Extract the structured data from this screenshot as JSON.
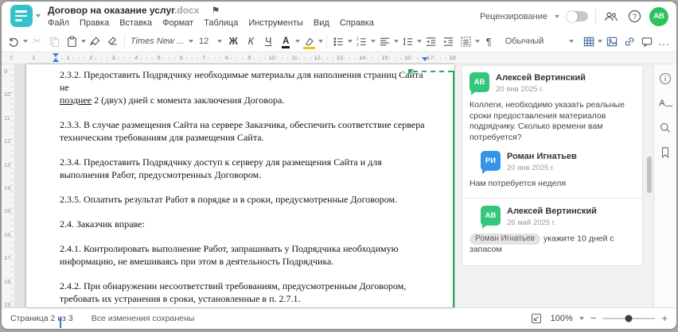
{
  "header": {
    "title": "Договор на оказание услуг",
    "title_ext": ".docx",
    "menu": [
      "Файл",
      "Правка",
      "Вставка",
      "Формат",
      "Таблица",
      "Инструменты",
      "Вид",
      "Справка"
    ],
    "review_label": "Рецензирование",
    "avatar_initials": "АВ"
  },
  "toolbar": {
    "font_name": "Times New ...",
    "font_size": "12",
    "bold_label": "Ж",
    "italic_label": "К",
    "underline_label": "Ч",
    "font_color_label": "А",
    "style_name": "Обычный",
    "pilcrow": "¶",
    "more_label": "..."
  },
  "ruler": {
    "h_left": [
      "2",
      "1"
    ],
    "h_numbers": [
      "1",
      "2",
      "3",
      "4",
      "5",
      "6",
      "7",
      "8",
      "9",
      "10",
      "11",
      "12",
      "13",
      "14",
      "15",
      "16",
      "17",
      "18"
    ],
    "v_numbers": [
      "9",
      "10",
      "11",
      "12",
      "13",
      "14",
      "15",
      "16",
      "17",
      "18",
      "19"
    ]
  },
  "document": {
    "p1_line1": "2.3.2. Предоставить Подрядчику необходимые материалы для наполнения страниц Сайта не",
    "p1_underlined": "позднее",
    "p1_rest": " 2 (двух) дней с момента заключения Договора.",
    "p2": "2.3.3. В случае размещения Сайта на сервере Заказчика, обеспечить соответствие сервера техническим требованиям для размещения Сайта.",
    "p3": "2.3.4. Предоставить Подрядчику доступ к серверу для размещения Сайта и для выполнения Работ, предусмотренных Договором.",
    "p4": "2.3.5. Оплатить результат Работ в порядке и в сроки, предусмотренные Договором.",
    "p5": "2.4. Заказчик вправе:",
    "p6": "2.4.1. Контролировать выполнение Работ, запрашивать у Подрядчика необходимую информацию, не вмешиваясь при этом в деятельность Подрядчика.",
    "p7": "2.4.2. При обнаружении несоответствий требованиям, предусмотренным Договором, требовать их устранения в сроки, установленные в п. 2.7.1."
  },
  "comments": {
    "items": [
      {
        "initials": "АВ",
        "name": "Алексей Вертинский",
        "date": "20 янв 2025 г.",
        "text": "Коллеги, необходимо указать реальные сроки предоставления материалов подрядчику. Сколько времени вам потребуется?"
      },
      {
        "initials": "РИ",
        "name": "Роман Игнатьев",
        "date": "20 янв 2025 г.",
        "text": "Нам потребуется неделя"
      },
      {
        "initials": "АВ",
        "name": "Алексей Вертинский",
        "date": "26 май 2025 г.",
        "mention": "Роман Игнатьев",
        "text": "укажите 10 дней с запасом"
      }
    ]
  },
  "statusbar": {
    "page_label": "Страница 2 из 3",
    "saved_label": "Все изменения сохранены",
    "zoom_value": "100%",
    "minus": "−",
    "plus": "+"
  },
  "colors": {
    "app_teal": "#35c1cc",
    "collab_green": "#21ae57",
    "avatar_green": "#34c77b",
    "avatar_blue": "#3495e8",
    "accent_blue": "#44689d"
  }
}
